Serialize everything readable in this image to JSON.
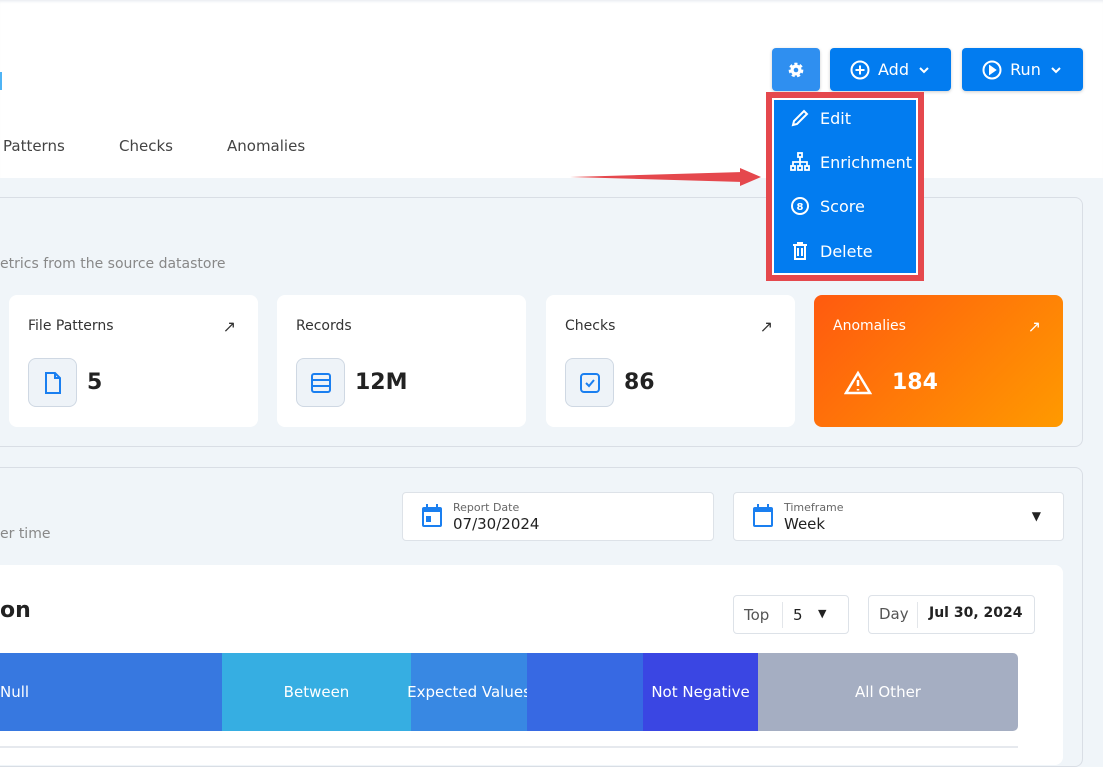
{
  "header": {
    "tabs": [
      "Patterns",
      "Checks",
      "Anomalies"
    ],
    "settings_icon": "gear-icon",
    "add_label": "Add",
    "run_label": "Run"
  },
  "menu": {
    "items": [
      {
        "label": "Edit",
        "icon": "pencil-icon"
      },
      {
        "label": "Enrichment",
        "icon": "hierarchy-icon"
      },
      {
        "label": "Score",
        "icon": "score-icon"
      },
      {
        "label": "Delete",
        "icon": "trash-icon"
      }
    ]
  },
  "overview": {
    "subtitle": "etrics from the source datastore",
    "cards": [
      {
        "label": "File Patterns",
        "value": "5"
      },
      {
        "label": "Records",
        "value": "12M"
      },
      {
        "label": "Checks",
        "value": "86"
      },
      {
        "label": "Anomalies",
        "value": "184"
      }
    ]
  },
  "activity": {
    "subtitle": "er time",
    "report_date_label": "Report Date",
    "report_date": "07/30/2024",
    "timeframe_label": "Timeframe",
    "timeframe": "Week"
  },
  "distribution": {
    "title": "on",
    "top_label": "Top",
    "top_value": "5",
    "day_label": "Day",
    "day_value": "Jul 30, 2024",
    "segments": [
      {
        "label": "Null",
        "color": "#3778e0"
      },
      {
        "label": "Between",
        "color": "#36aee2"
      },
      {
        "label": "Expected Values",
        "color": "#3888e3"
      },
      {
        "label": "",
        "color": "#3769e3"
      },
      {
        "label": "Not Negative",
        "color": "#3a46e3"
      },
      {
        "label": "All Other",
        "color": "#a5aec2"
      }
    ]
  },
  "colors": {
    "primary": "#027cf0",
    "highlight": "#e5484d",
    "anomaly_gradient": [
      "#ff5a0f",
      "#ff9a00"
    ]
  }
}
